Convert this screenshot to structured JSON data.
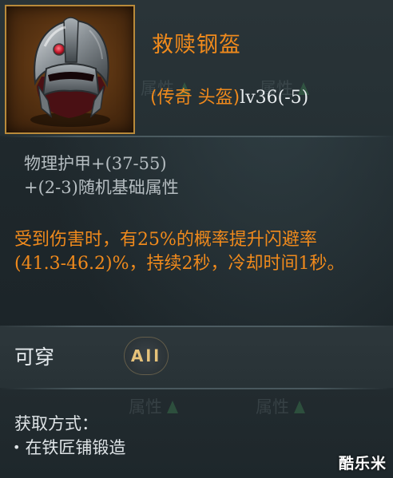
{
  "item": {
    "name": "救赎钢盔",
    "rarity_slot": "(传奇 头盔)",
    "level": "lv36(-5)",
    "icon": "legendary-helmet-icon"
  },
  "stats": {
    "line1_label": "物理护甲+",
    "line1_value": "(37-55)",
    "line2_prefix": "+(2-3)",
    "line2_label": "随机基础属性"
  },
  "effect": {
    "part1": "受到伤害时，有",
    "chance": "25%",
    "part2": "的概率提升闪避率",
    "range": "(41.3-46.2)%",
    "part3": "，持续",
    "duration": "2",
    "part4": "秒，冷却时间",
    "cooldown": "1",
    "part5": "秒。"
  },
  "wearable": {
    "label": "可穿",
    "class": "All"
  },
  "acquisition": {
    "title": "获取方式：",
    "method": "在铁匠铺锻造"
  },
  "background_labels": [
    "属性",
    "属性",
    "属性",
    "属性"
  ],
  "watermark": "酷乐米",
  "colors": {
    "legendary_orange": "#f08a1c",
    "icon_border_gold": "#b98a3a",
    "panel_bg": "#1c2428"
  }
}
